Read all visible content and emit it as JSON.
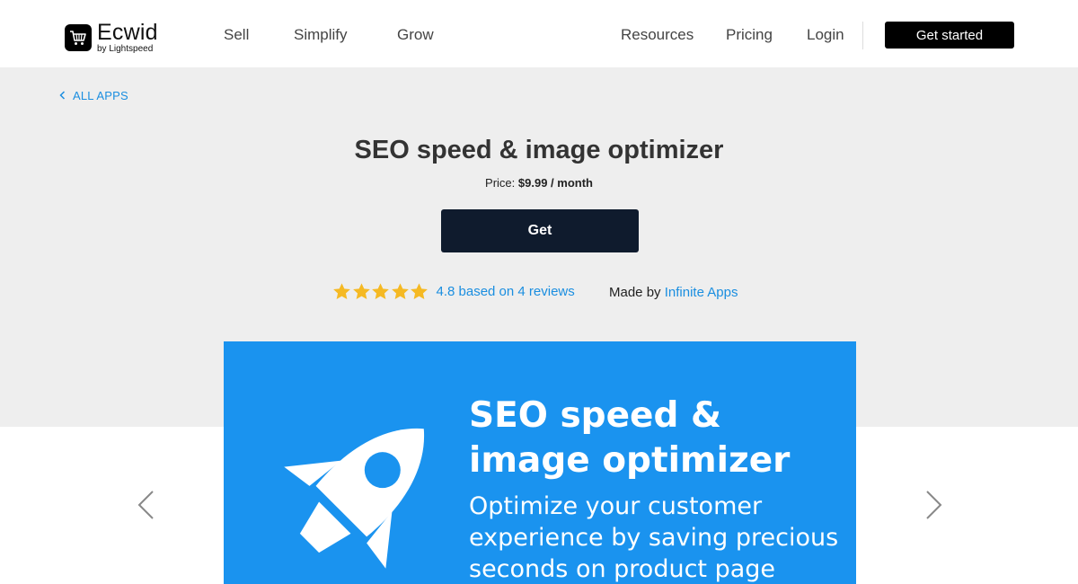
{
  "header": {
    "logo": {
      "name": "Ecwid",
      "sub": "by Lightspeed"
    },
    "nav_left": [
      {
        "label": "Sell"
      },
      {
        "label": "Simplify"
      },
      {
        "label": "Grow"
      }
    ],
    "nav_right": [
      {
        "label": "Resources"
      },
      {
        "label": "Pricing"
      },
      {
        "label": "Login"
      }
    ],
    "cta_label": "Get started"
  },
  "hero": {
    "back_label": "ALL APPS",
    "title": "SEO speed & image optimizer",
    "price_prefix": "Price:",
    "price_value": "$9.99 / month",
    "get_label": "Get",
    "rating": {
      "stars": 5,
      "text": "4.8 based on 4 reviews",
      "color": "#f5b923"
    },
    "made_by_prefix": "Made by",
    "made_by_vendor": "Infinite Apps"
  },
  "banner": {
    "title": "SEO speed & image optimizer",
    "subtitle": "Optimize your customer experience by saving precious seconds on product page",
    "background": "#1a93ef"
  },
  "colors": {
    "accent_link": "#1a8ee0",
    "button_dark": "#0f1b2d",
    "hero_bg": "#eeeeee"
  },
  "icons": {
    "back": "chevron-left-icon",
    "prev": "chevron-left-icon",
    "next": "chevron-right-icon",
    "rocket": "rocket-icon",
    "logo": "cart-icon"
  }
}
